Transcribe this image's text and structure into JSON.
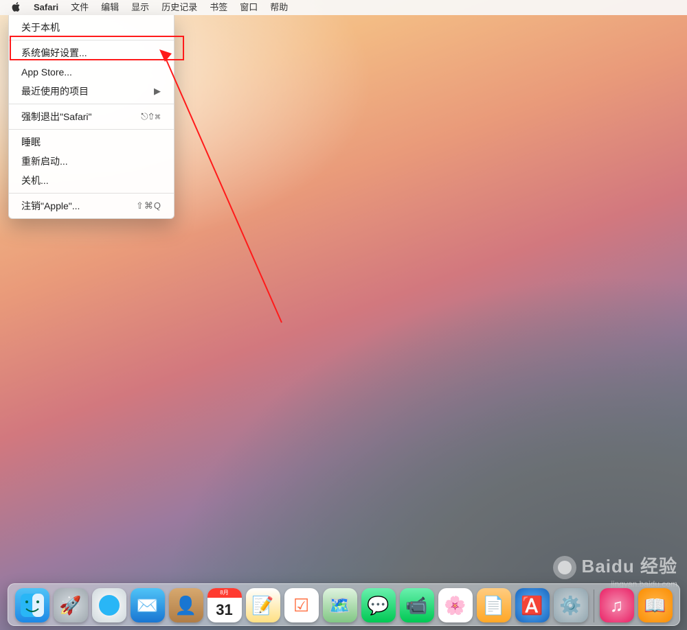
{
  "menubar": {
    "app_name": "Safari",
    "items": [
      "文件",
      "编辑",
      "显示",
      "历史记录",
      "书签",
      "窗口",
      "帮助"
    ]
  },
  "apple_menu": {
    "about": "关于本机",
    "prefs": "系统偏好设置...",
    "appstore": "App Store...",
    "recent": "最近使用的项目",
    "forcequit": "强制退出\"Safari\"",
    "forcequit_shortcut": "⎋⇧⌘",
    "sleep": "睡眠",
    "restart": "重新启动...",
    "shutdown": "关机...",
    "logout": "注销\"Apple\"...",
    "logout_shortcut": "⇧⌘Q"
  },
  "calendar": {
    "month": "8月",
    "day": "31"
  },
  "watermark": {
    "brand": "Baidu 经验",
    "url": "jingyan.baidu.com"
  },
  "dock": {
    "finder": "Finder",
    "launchpad": "Launchpad",
    "safari": "Safari",
    "mail": "邮件",
    "contacts": "通讯录",
    "calendar": "日历",
    "notes": "备忘录",
    "reminders": "提醒事项",
    "maps": "地图",
    "messages": "信息",
    "facetime": "FaceTime",
    "photos": "照片",
    "pages": "Pages",
    "appstore": "App Store",
    "sysprefs": "系统偏好设置",
    "itunes": "iTunes",
    "ibooks": "iBooks"
  }
}
